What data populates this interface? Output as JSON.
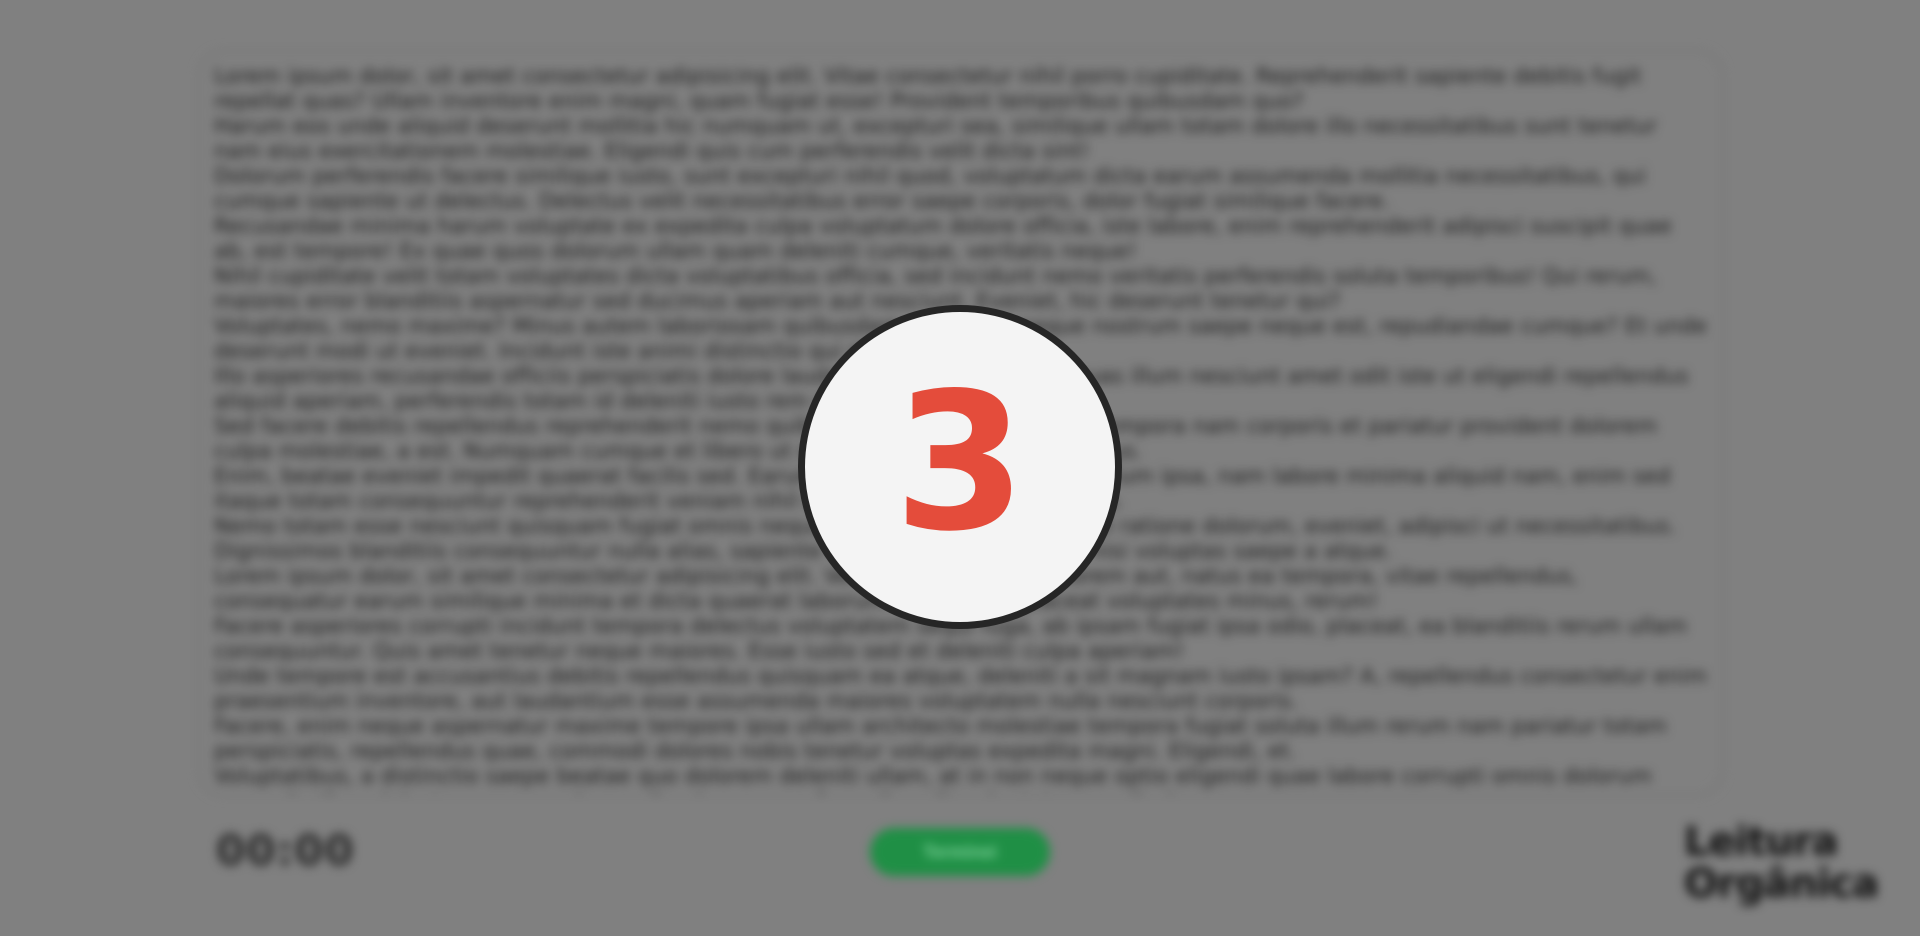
{
  "reading": {
    "paragraphs": [
      "Lorem ipsum dolor, sit amet consectetur adipisicing elit. Vitae consectetur nihil porro cupiditate. Reprehenderit sapiente debitis fugit repellat quas? Ullam inventore enim magni, quam fugiat esse! Provident temporibus quibusdam quo?",
      "Harum eos unde aliquid deserunt mollitia hic numquam ut, excepturi sea, similique ullam totam dolore illo necessitatibus sunt tenetur nam eius exercitationem molestiae. Eligendi quis cum perferendis velit dicta sint!",
      "Dolorum perferendis facere similique iusto, sunt excepturi nihil quod, voluptatum dicta earum assumenda mollitia necessitatibus, qui cumque sapiente ut delectus. Delectus velit necessitatibus error saepe corporis, dolor fugiat similique facere.",
      "Recusandae minima harum voluptate ex expedita culpa voluptatum dolore officia, iste labore, enim reprehenderit adipisci suscipit quae ab, est tempore! Ex quae quos dolorum ullam quam deleniti cumque, veritatis neque!",
      "Nihil cupiditate velit totam voluptates dicta voluptatibus officia, sed incidunt nemo veritatis perferendis soluta temporibus! Qui rerum, maiores error blanditiis aspernatur sed ducimus aperiam aut nesciunt. Eveniet, hic deserunt tenetur qui?",
      "Voluptates, nemo maxime? Minus autem laboriosam quibusdam eum alias neque nostrum saepe neque est, repudiandae cumque? Et unde deserunt modi ut eveniet. Incidunt iste animi distinctio qui minima temporibus.",
      "Illo asperiores recusandae officiis perspiciatis dolore laudantium velit, facere ut quas illum nesciunt amet odit iste ut eligendi repellendus aliquid aperiam, perferendis totam id deleniti iusto rem earum doloremque.",
      "Sed facere debitis repellendus reprehenderit nemo quibusdam quas ipsum magni tempora nam corporis et pariatur provident dolorem culpa molestiae, a est. Numquam cumque et libero ut modi veniam quas voluptatibus.",
      "Enim, beatae eveniet impedit quaerat facilis sed. Earum illum consectetur accusantium ipsa, nam labore minima aliquid nam, enim sed itaque totam consequuntur reprehenderit veniam nihil debitis recusandae explicabo.",
      "Nemo totam esse nesciunt quisquam fugiat omnis neque sit magni suscipit eligendi ratione dolorum, eveniet, adipisci ut necessitatibus. Dignissimos blanditiis consequuntur nulla alias, sapiente cumque beatae impedit nisi voluptas saepe a atque.",
      "Lorem ipsum dolor, sit amet consectetur adipisicing elit. Veniam est suscipit dolorem aut, natus ea tempora, vitae repellendus, consequatur earum similique minima et dicta quaerat laborum quas atque placeat voluptates minus, rerum!",
      "Facere asperiores corrupti incidunt tempora delectus voluptatem sequi fuga, ab ipsam fugiat ipsa odio, placeat, ea blanditiis rerum ullam consequuntur. Quis amet tenetur neque maiores. Esse iusto sed et deleniti culpa aperiam!",
      "Unde tempore est accusantius debitis repellendus quisquam ea atque, deleniti a sit magnam iusto ipsam? A, repellendus consectetur enim praesentium inventore, aut laudantium esse assumenda maiores voluptatem nulla nesciunt corporis.",
      "Facere, enim neque aspernatur maxime tempore ipsa ullam architecto molestiae tempora fugiat soluta illum rerum nam pariatur totam perspiciatis, repellendus quae, commodi dolores nobis tenetur voluptas expedita magni. Eligendi, et.",
      "Voluptatibus, a distinctio saepe beatae quo dolorem deleniti ullam, at in non neque optio eligendi quae labore corrupti omnis dolorum necessitatibus delectus assumenda repellendus quo perferendis velit voluptatem explicabo."
    ]
  },
  "timer": {
    "value": "00:00"
  },
  "finish_button": {
    "label": "Terminei"
  },
  "logo": {
    "line1": "Leitura",
    "line2": "Orgânica"
  },
  "countdown": {
    "value": "3"
  },
  "colors": {
    "overlay": "#808080",
    "accent_green": "#1f8f45",
    "countdown_red": "#e44c3b",
    "countdown_bg": "#f4f4f4",
    "countdown_border": "#262626"
  }
}
